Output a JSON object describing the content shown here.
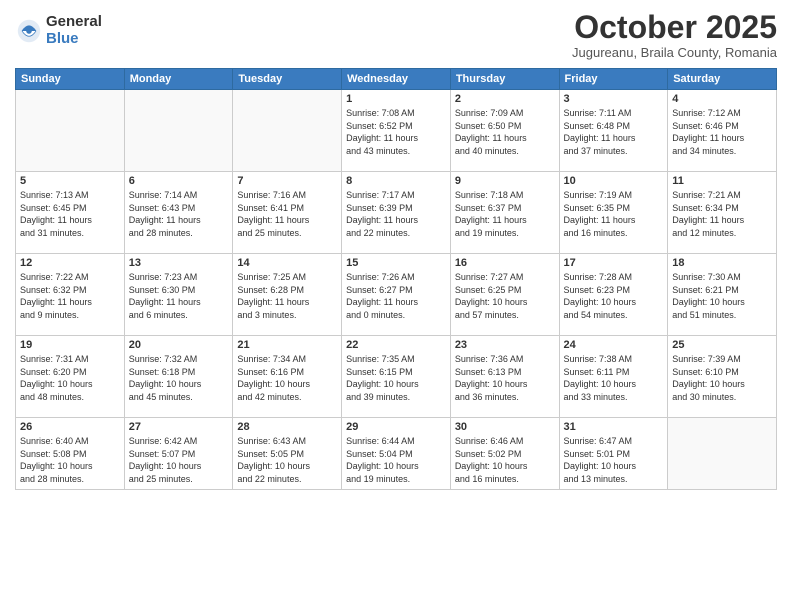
{
  "logo": {
    "general": "General",
    "blue": "Blue"
  },
  "title": "October 2025",
  "subtitle": "Jugureanu, Braila County, Romania",
  "headers": [
    "Sunday",
    "Monday",
    "Tuesday",
    "Wednesday",
    "Thursday",
    "Friday",
    "Saturday"
  ],
  "weeks": [
    [
      {
        "day": "",
        "info": ""
      },
      {
        "day": "",
        "info": ""
      },
      {
        "day": "",
        "info": ""
      },
      {
        "day": "1",
        "info": "Sunrise: 7:08 AM\nSunset: 6:52 PM\nDaylight: 11 hours\nand 43 minutes."
      },
      {
        "day": "2",
        "info": "Sunrise: 7:09 AM\nSunset: 6:50 PM\nDaylight: 11 hours\nand 40 minutes."
      },
      {
        "day": "3",
        "info": "Sunrise: 7:11 AM\nSunset: 6:48 PM\nDaylight: 11 hours\nand 37 minutes."
      },
      {
        "day": "4",
        "info": "Sunrise: 7:12 AM\nSunset: 6:46 PM\nDaylight: 11 hours\nand 34 minutes."
      }
    ],
    [
      {
        "day": "5",
        "info": "Sunrise: 7:13 AM\nSunset: 6:45 PM\nDaylight: 11 hours\nand 31 minutes."
      },
      {
        "day": "6",
        "info": "Sunrise: 7:14 AM\nSunset: 6:43 PM\nDaylight: 11 hours\nand 28 minutes."
      },
      {
        "day": "7",
        "info": "Sunrise: 7:16 AM\nSunset: 6:41 PM\nDaylight: 11 hours\nand 25 minutes."
      },
      {
        "day": "8",
        "info": "Sunrise: 7:17 AM\nSunset: 6:39 PM\nDaylight: 11 hours\nand 22 minutes."
      },
      {
        "day": "9",
        "info": "Sunrise: 7:18 AM\nSunset: 6:37 PM\nDaylight: 11 hours\nand 19 minutes."
      },
      {
        "day": "10",
        "info": "Sunrise: 7:19 AM\nSunset: 6:35 PM\nDaylight: 11 hours\nand 16 minutes."
      },
      {
        "day": "11",
        "info": "Sunrise: 7:21 AM\nSunset: 6:34 PM\nDaylight: 11 hours\nand 12 minutes."
      }
    ],
    [
      {
        "day": "12",
        "info": "Sunrise: 7:22 AM\nSunset: 6:32 PM\nDaylight: 11 hours\nand 9 minutes."
      },
      {
        "day": "13",
        "info": "Sunrise: 7:23 AM\nSunset: 6:30 PM\nDaylight: 11 hours\nand 6 minutes."
      },
      {
        "day": "14",
        "info": "Sunrise: 7:25 AM\nSunset: 6:28 PM\nDaylight: 11 hours\nand 3 minutes."
      },
      {
        "day": "15",
        "info": "Sunrise: 7:26 AM\nSunset: 6:27 PM\nDaylight: 11 hours\nand 0 minutes."
      },
      {
        "day": "16",
        "info": "Sunrise: 7:27 AM\nSunset: 6:25 PM\nDaylight: 10 hours\nand 57 minutes."
      },
      {
        "day": "17",
        "info": "Sunrise: 7:28 AM\nSunset: 6:23 PM\nDaylight: 10 hours\nand 54 minutes."
      },
      {
        "day": "18",
        "info": "Sunrise: 7:30 AM\nSunset: 6:21 PM\nDaylight: 10 hours\nand 51 minutes."
      }
    ],
    [
      {
        "day": "19",
        "info": "Sunrise: 7:31 AM\nSunset: 6:20 PM\nDaylight: 10 hours\nand 48 minutes."
      },
      {
        "day": "20",
        "info": "Sunrise: 7:32 AM\nSunset: 6:18 PM\nDaylight: 10 hours\nand 45 minutes."
      },
      {
        "day": "21",
        "info": "Sunrise: 7:34 AM\nSunset: 6:16 PM\nDaylight: 10 hours\nand 42 minutes."
      },
      {
        "day": "22",
        "info": "Sunrise: 7:35 AM\nSunset: 6:15 PM\nDaylight: 10 hours\nand 39 minutes."
      },
      {
        "day": "23",
        "info": "Sunrise: 7:36 AM\nSunset: 6:13 PM\nDaylight: 10 hours\nand 36 minutes."
      },
      {
        "day": "24",
        "info": "Sunrise: 7:38 AM\nSunset: 6:11 PM\nDaylight: 10 hours\nand 33 minutes."
      },
      {
        "day": "25",
        "info": "Sunrise: 7:39 AM\nSunset: 6:10 PM\nDaylight: 10 hours\nand 30 minutes."
      }
    ],
    [
      {
        "day": "26",
        "info": "Sunrise: 6:40 AM\nSunset: 5:08 PM\nDaylight: 10 hours\nand 28 minutes."
      },
      {
        "day": "27",
        "info": "Sunrise: 6:42 AM\nSunset: 5:07 PM\nDaylight: 10 hours\nand 25 minutes."
      },
      {
        "day": "28",
        "info": "Sunrise: 6:43 AM\nSunset: 5:05 PM\nDaylight: 10 hours\nand 22 minutes."
      },
      {
        "day": "29",
        "info": "Sunrise: 6:44 AM\nSunset: 5:04 PM\nDaylight: 10 hours\nand 19 minutes."
      },
      {
        "day": "30",
        "info": "Sunrise: 6:46 AM\nSunset: 5:02 PM\nDaylight: 10 hours\nand 16 minutes."
      },
      {
        "day": "31",
        "info": "Sunrise: 6:47 AM\nSunset: 5:01 PM\nDaylight: 10 hours\nand 13 minutes."
      },
      {
        "day": "",
        "info": ""
      }
    ]
  ]
}
